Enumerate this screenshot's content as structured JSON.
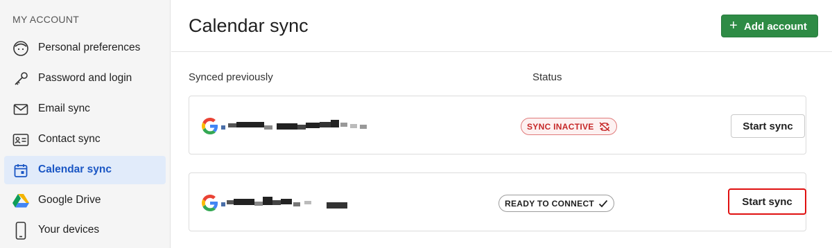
{
  "sidebar": {
    "heading": "MY ACCOUNT",
    "items": [
      {
        "label": "Personal preferences",
        "icon": "face-icon"
      },
      {
        "label": "Password and login",
        "icon": "key-icon"
      },
      {
        "label": "Email sync",
        "icon": "envelope-icon"
      },
      {
        "label": "Contact sync",
        "icon": "contact-card-icon"
      },
      {
        "label": "Calendar sync",
        "icon": "calendar-icon",
        "active": true
      },
      {
        "label": "Google Drive",
        "icon": "google-drive-icon"
      },
      {
        "label": "Your devices",
        "icon": "phone-icon"
      }
    ]
  },
  "header": {
    "title": "Calendar sync",
    "add_button_label": "Add account",
    "add_button_icon": "plus-icon"
  },
  "table": {
    "col_synced": "Synced previously",
    "col_status": "Status",
    "rows": [
      {
        "provider_icon": "google-logo-icon",
        "account": "redacted",
        "status": "SYNC INACTIVE",
        "status_icon": "sync-off-icon",
        "status_color": "#c62828",
        "action": "Start sync"
      },
      {
        "provider_icon": "google-logo-icon",
        "account": "redacted",
        "status": "READY TO CONNECT",
        "status_icon": "check-icon",
        "status_color": "#1f1f1f",
        "action": "Start sync"
      }
    ]
  },
  "colors": {
    "accent_green": "#2e8b45",
    "active_blue": "#1a56c4",
    "highlight_red": "#e01010"
  }
}
